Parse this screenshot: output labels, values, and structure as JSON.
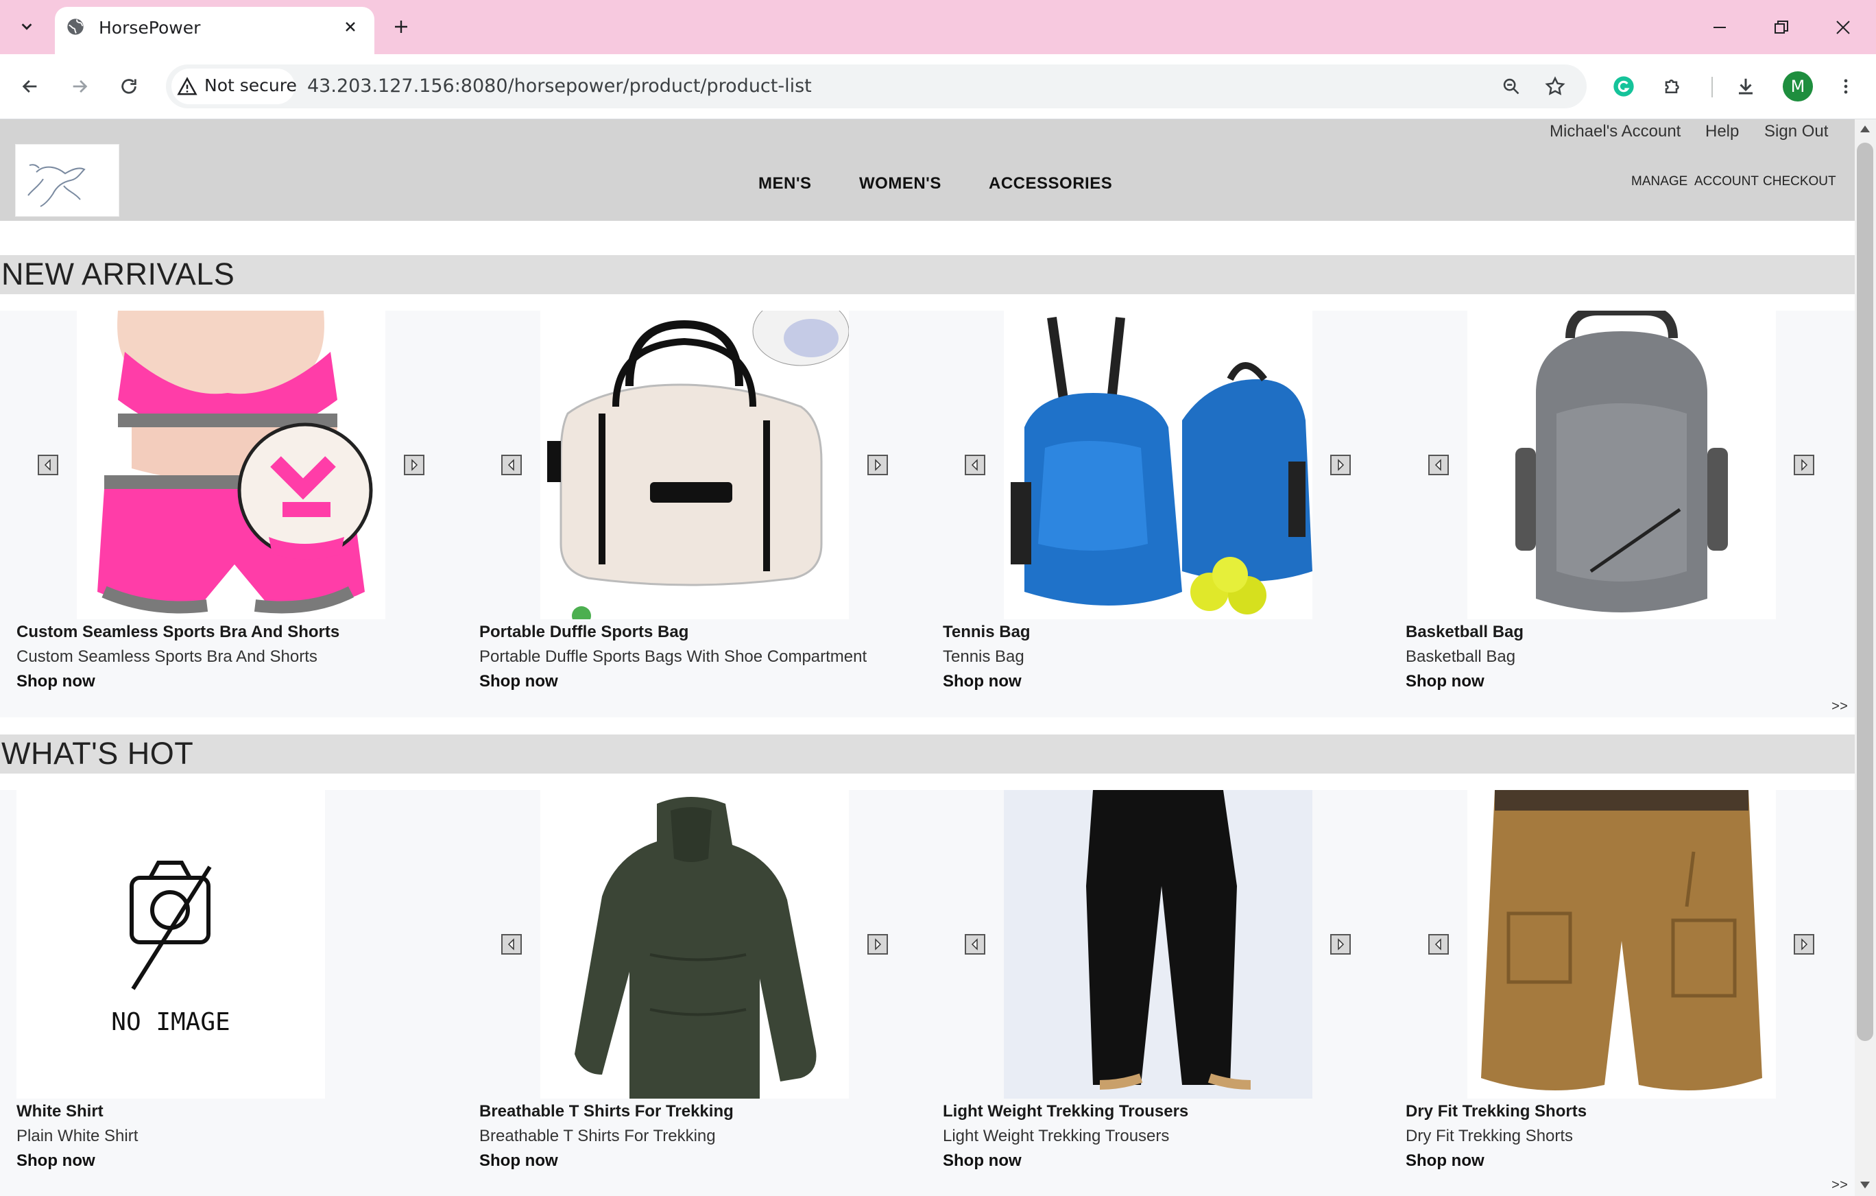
{
  "browser": {
    "tab_title": "HorsePower",
    "security_label": "Not secure",
    "url": "43.203.127.156:8080/horsepower/product/product-list",
    "profile_initial": "M"
  },
  "header": {
    "top_links": [
      "Michael's Account",
      "Help",
      "Sign Out"
    ],
    "nav": [
      "MEN'S",
      "WOMEN'S",
      "ACCESSORIES"
    ],
    "sub_links": [
      "MANAGE",
      "ACCOUNT",
      "CHECKOUT"
    ]
  },
  "new_arrivals": {
    "title": "NEW ARRIVALS",
    "more": ">>",
    "products": [
      {
        "name": "Custom Seamless Sports Bra And Shorts",
        "desc": "Custom Seamless Sports Bra And Shorts",
        "cta": "Shop now"
      },
      {
        "name": "Portable Duffle Sports Bag",
        "desc": "Portable Duffle Sports Bags With Shoe Compartment",
        "cta": "Shop now"
      },
      {
        "name": "Tennis Bag",
        "desc": "Tennis Bag",
        "cta": "Shop now"
      },
      {
        "name": "Basketball Bag",
        "desc": "Basketball Bag",
        "cta": "Shop now"
      }
    ]
  },
  "whats_hot": {
    "title": "WHAT'S HOT",
    "more": ">>",
    "no_image_label": "NO IMAGE",
    "products": [
      {
        "name": "White Shirt",
        "desc": "Plain White Shirt",
        "cta": "Shop now"
      },
      {
        "name": "Breathable T Shirts For Trekking",
        "desc": "Breathable T Shirts For Trekking",
        "cta": "Shop now"
      },
      {
        "name": "Light Weight Trekking Trousers",
        "desc": "Light Weight Trekking Trousers",
        "cta": "Shop now"
      },
      {
        "name": "Dry Fit Trekking Shorts",
        "desc": "Dry Fit Trekking Shorts",
        "cta": "Shop now"
      }
    ]
  },
  "colors": {
    "tab_strip": "#f7c9df",
    "header_bg": "#d3d3d3",
    "section_bar": "#dedede"
  }
}
